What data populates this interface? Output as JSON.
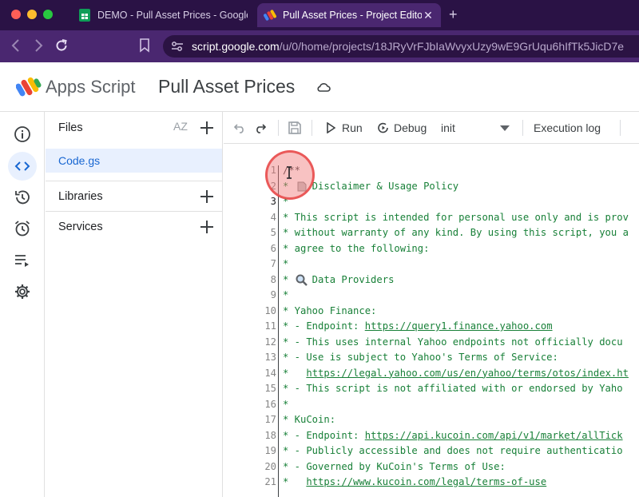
{
  "browser": {
    "tabs": [
      {
        "title": "DEMO - Pull Asset Prices - Google Sheets",
        "icon": "sheets-icon",
        "active": false
      },
      {
        "title": "Pull Asset Prices - Project Editor",
        "icon": "apps-script-icon",
        "active": true
      }
    ],
    "new_tab_glyph": "+",
    "close_glyph": "✕",
    "url_host": "script.google.com",
    "url_path": "/u/0/home/projects/18JRyVrFJbIaWvyxUzy9wE9GrUqu6hIfTk5JicD7e"
  },
  "app": {
    "brand": "Apps Script",
    "project_title": "Pull Asset Prices"
  },
  "files_panel": {
    "header": "Files",
    "sort_label": "AZ",
    "files": [
      "Code.gs"
    ],
    "sections": [
      "Libraries",
      "Services"
    ]
  },
  "toolbar": {
    "run": "Run",
    "debug": "Debug",
    "function_selected": "init",
    "execution_log": "Execution log"
  },
  "editor": {
    "line_numbers": [
      "1",
      "2",
      "3",
      "4",
      "5",
      "6",
      "7",
      "8",
      "9",
      "10",
      "11",
      "12",
      "13",
      "14",
      "15",
      "16",
      "17",
      "18",
      "19",
      "20",
      "21"
    ],
    "current_line": 3,
    "lines": [
      "/**",
      "*    Disclaimer & Usage Policy",
      "*",
      "* This script is intended for personal use only and is prov",
      "* without warranty of any kind. By using this script, you a",
      "* agree to the following:",
      "*",
      "*    Data Providers",
      "*",
      "* Yahoo Finance:",
      "* - Endpoint: ",
      "* - This uses internal Yahoo endpoints not officially docu",
      "* - Use is subject to Yahoo's Terms of Service:",
      "*   ",
      "* - This script is not affiliated with or endorsed by Yaho",
      "*",
      "* KuCoin:",
      "* - Endpoint: ",
      "* - Publicly accessible and does not require authenticatio",
      "* - Governed by KuCoin's Terms of Use:",
      "*   "
    ],
    "links": {
      "yahoo_endpoint": "https://query1.finance.yahoo.com",
      "yahoo_terms": "https://legal.yahoo.com/us/en/yahoo/terms/otos/index.ht",
      "kucoin_endpoint": "https://api.kucoin.com/api/v1/market/allTick",
      "kucoin_terms": "https://www.kucoin.com/legal/terms-of-use"
    }
  },
  "colors": {
    "tab_bar": "#2a1245",
    "address_bar": "#4a2770",
    "code_green": "#188038",
    "active_blue": "#1967d2"
  }
}
